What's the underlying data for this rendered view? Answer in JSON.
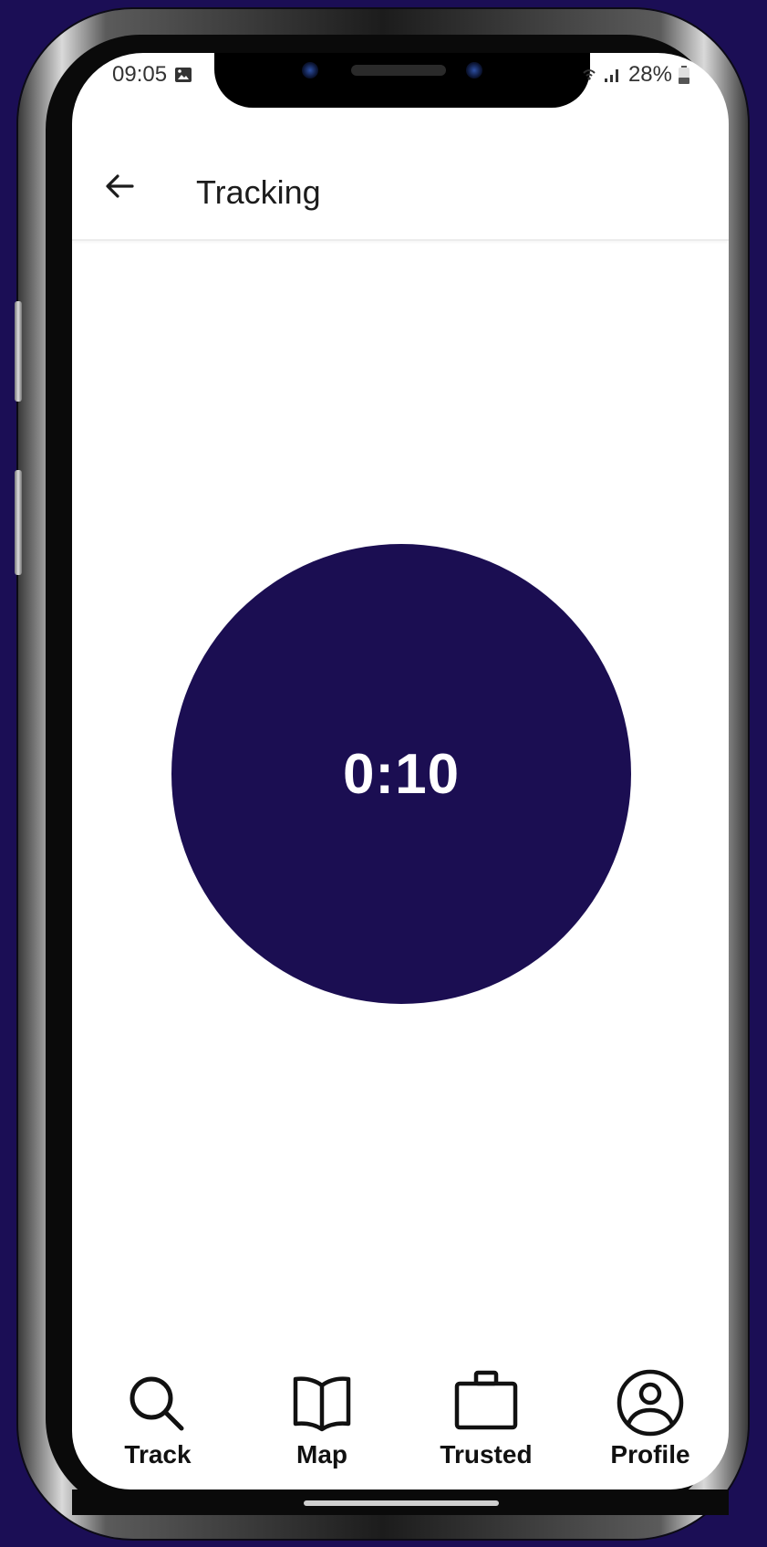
{
  "status_bar": {
    "time": "09:05",
    "battery": "28%"
  },
  "header": {
    "back_icon": "arrow-left-icon",
    "title": "Tracking"
  },
  "timer": {
    "value": "0:10",
    "color": "#1b0e52"
  },
  "bottom_nav": {
    "items": [
      {
        "label": "Track",
        "icon": "search-icon"
      },
      {
        "label": "Map",
        "icon": "book-map-icon"
      },
      {
        "label": "Trusted",
        "icon": "briefcase-icon"
      },
      {
        "label": "Profile",
        "icon": "user-circle-icon"
      }
    ]
  },
  "colors": {
    "background": "#1b0e55",
    "accent": "#1b0e52",
    "surface": "#ffffff"
  }
}
